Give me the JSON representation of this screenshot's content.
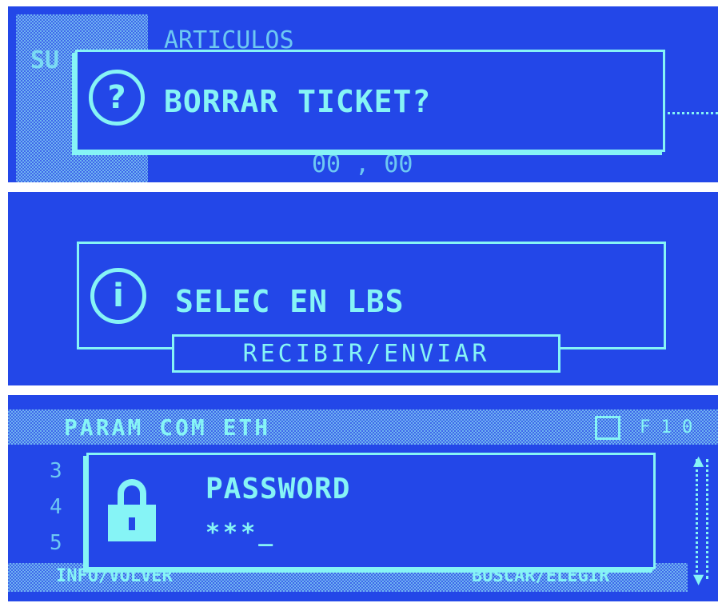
{
  "screens": {
    "delete": {
      "background_menu": "ARTICULOS",
      "background_side": "SU",
      "background_value": "00 , 00",
      "dialog_text": "BORRAR TICKET?",
      "icon": "question-icon"
    },
    "units": {
      "dialog_text": "SELEC EN LBS",
      "button_label": "RECIBIR/ENVIAR",
      "icon": "info-icon"
    },
    "password": {
      "header": "PARAM COM ETH",
      "header_right": "F 1 0",
      "row_numbers": [
        "3",
        "4",
        "5"
      ],
      "title": "PASSWORD",
      "value": "***_",
      "footer_left": "INFO/VOLVER",
      "footer_right": "BUSCAR/ELEGIR",
      "icon": "lock-icon"
    }
  },
  "colors": {
    "lcd_background": "#2347e8",
    "lcd_foreground": "#86f4f6"
  }
}
